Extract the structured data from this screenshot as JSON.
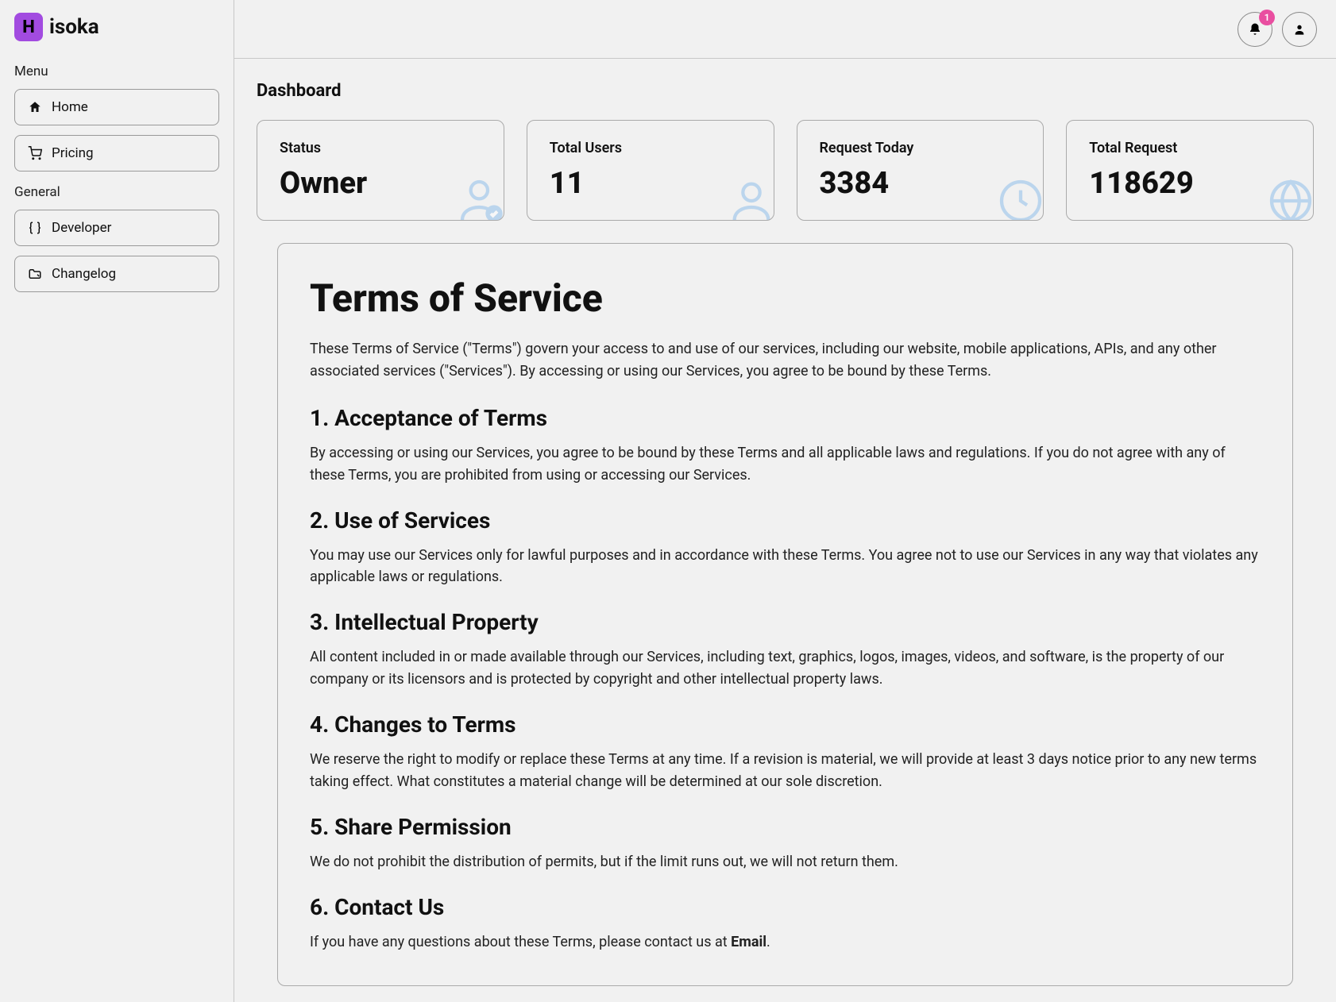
{
  "brand": {
    "logo_letter": "H",
    "name": "isoka"
  },
  "sidebar": {
    "menu_label": "Menu",
    "general_label": "General",
    "menu_items": [
      {
        "label": "Home",
        "icon": "home-icon"
      },
      {
        "label": "Pricing",
        "icon": "cart-icon"
      }
    ],
    "general_items": [
      {
        "label": "Developer",
        "icon": "braces-icon"
      },
      {
        "label": "Changelog",
        "icon": "folder-icon"
      }
    ]
  },
  "topbar": {
    "notification_count": "1"
  },
  "page": {
    "title": "Dashboard"
  },
  "stats": [
    {
      "label": "Status",
      "value": "Owner",
      "icon": "user-check"
    },
    {
      "label": "Total Users",
      "value": "11",
      "icon": "user"
    },
    {
      "label": "Request Today",
      "value": "3384",
      "icon": "clock"
    },
    {
      "label": "Total Request",
      "value": "118629",
      "icon": "globe"
    }
  ],
  "tos": {
    "title": "Terms of Service",
    "intro": "These Terms of Service (\"Terms\") govern your access to and use of our services, including our website, mobile applications, APIs, and any other associated services (\"Services\"). By accessing or using our Services, you agree to be bound by these Terms.",
    "sections": [
      {
        "title": "1. Acceptance of Terms",
        "body": "By accessing or using our Services, you agree to be bound by these Terms and all applicable laws and regulations. If you do not agree with any of these Terms, you are prohibited from using or accessing our Services."
      },
      {
        "title": "2. Use of Services",
        "body": "You may use our Services only for lawful purposes and in accordance with these Terms. You agree not to use our Services in any way that violates any applicable laws or regulations."
      },
      {
        "title": "3. Intellectual Property",
        "body": "All content included in or made available through our Services, including text, graphics, logos, images, videos, and software, is the property of our company or its licensors and is protected by copyright and other intellectual property laws."
      },
      {
        "title": "4. Changes to Terms",
        "body": "We reserve the right to modify or replace these Terms at any time. If a revision is material, we will provide at least 3 days notice prior to any new terms taking effect. What constitutes a material change will be determined at our sole discretion."
      },
      {
        "title": "5. Share Permission",
        "body": "We do not prohibit the distribution of permits, but if the limit runs out, we will not return them."
      },
      {
        "title": "6. Contact Us",
        "body_prefix": "If you have any questions about these Terms, please contact us at ",
        "email": "Email",
        "body_suffix": "."
      }
    ]
  }
}
